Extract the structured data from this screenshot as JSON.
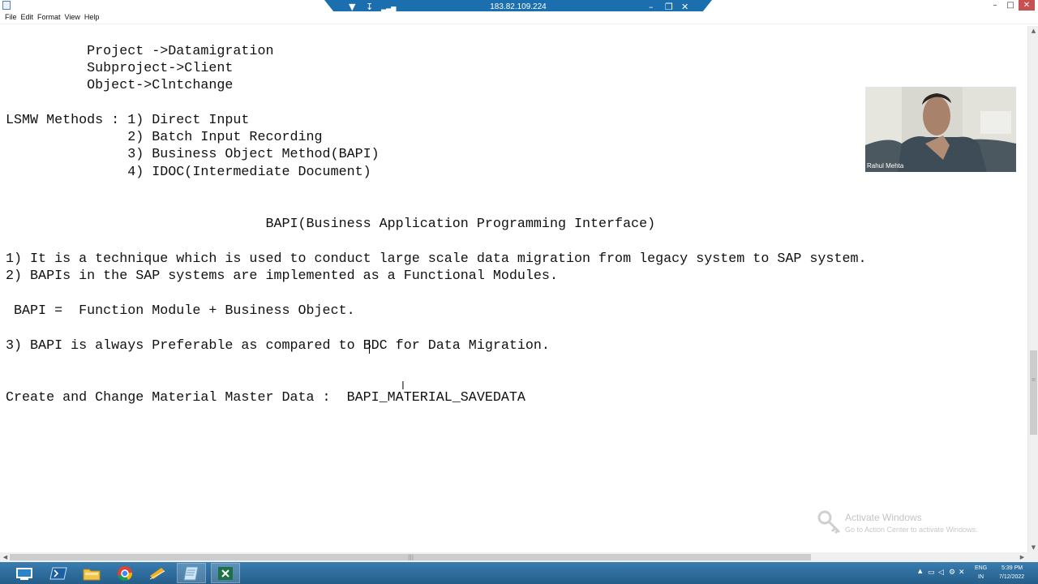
{
  "window": {
    "min_glyph": "–",
    "max_glyph": "□",
    "close_glyph": "✕"
  },
  "rdp": {
    "address": "183.82.109.224",
    "dropdown_glyph": "▼",
    "pin_glyph": "↧",
    "min_glyph": "–",
    "restore_glyph": "❐",
    "close_glyph": "✕"
  },
  "menu": [
    "File",
    "Edit",
    "Format",
    "View",
    "Help"
  ],
  "document": {
    "lines": [
      "          Project ->Datamigration",
      "          Subproject->Client",
      "          Object->Clntchange",
      "LSMW Methods : 1) Direct Input",
      "               2) Batch Input Recording",
      "               3) Business Object Method(BAPI)",
      "               4) IDOC(Intermediate Document)",
      "                                BAPI(Business Application Programming Interface)",
      "1) It is a technique which is used to conduct large scale data migration from legacy system to SAP system.",
      "2) BAPIs in the SAP systems are implemented as a Functional Modules.",
      " BAPI =  Function Module + Business Object.",
      "3) BAPI is always Preferable as compared to BDC for Data Migration.",
      "Create and Change Material Master Data :  BAPI_MATERIAL_SAVEDATA"
    ]
  },
  "webcam": {
    "participant": "Rahul Mehta"
  },
  "watermark": {
    "title": "Activate Windows",
    "subtitle": "Go to Action Center to activate Windows."
  },
  "taskbar": {
    "apps": [
      "start",
      "powershell",
      "file-explorer",
      "chrome",
      "sap-logon",
      "notepad",
      "excel"
    ],
    "lang_top": "ENG",
    "lang_bottom": "IN",
    "time": "5:39 PM",
    "date": "7/12/2022"
  }
}
